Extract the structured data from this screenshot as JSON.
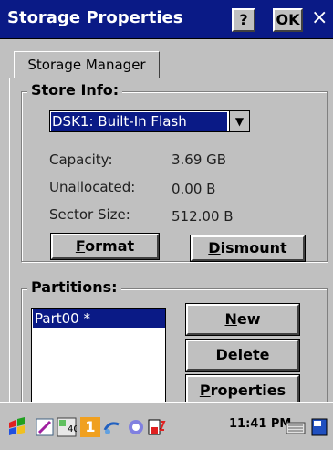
{
  "window": {
    "title": "Storage Properties",
    "help_button": "?",
    "ok_button": "OK",
    "close_button": "×"
  },
  "tabs": [
    {
      "label": "Storage Manager"
    }
  ],
  "store_info": {
    "group_title": "Store Info:",
    "selected_store": "DSK1: Built-In Flash",
    "fields": [
      {
        "label": "Capacity:",
        "value": "3.69 GB"
      },
      {
        "label": "Unallocated:",
        "value": "0.00 B"
      },
      {
        "label": "Sector Size:",
        "value": "512.00 B"
      }
    ],
    "buttons": {
      "format_mnemonic": "F",
      "format_rest": "ormat",
      "dismount_mnemonic": "D",
      "dismount_rest": "ismount"
    }
  },
  "partitions": {
    "group_title": "Partitions:",
    "items": [
      "Part00 *"
    ],
    "buttons": {
      "new_mnemonic": "N",
      "new_rest": "ew",
      "delete_pre": "D",
      "delete_mnemonic": "e",
      "delete_rest": "lete",
      "properties_mnemonic": "P",
      "properties_rest": "roperties"
    }
  },
  "taskbar": {
    "clock": "11:41 PM",
    "badge_number": "1"
  },
  "colors": {
    "title_bar": "#0a1a86",
    "selection": "#0a1a86",
    "face": "#c0c0c0"
  }
}
